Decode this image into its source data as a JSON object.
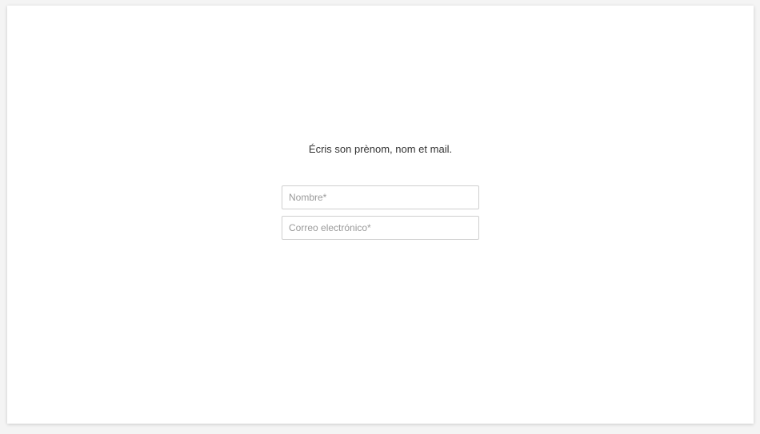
{
  "form": {
    "prompt": "Écris son prènom, nom et mail.",
    "name_field": {
      "placeholder": "Nombre*",
      "value": ""
    },
    "email_field": {
      "placeholder": "Correo electrónico*",
      "value": ""
    }
  }
}
